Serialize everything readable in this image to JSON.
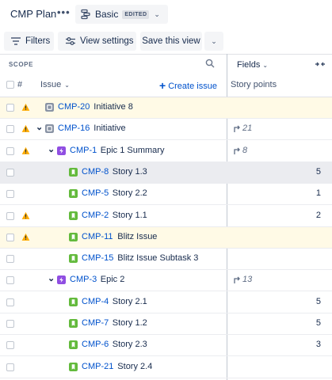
{
  "header": {
    "plan_title": "CMP Plan",
    "more_label": "•••",
    "view_name": "Basic",
    "view_badge": "EDITED"
  },
  "toolbar": {
    "filters_label": "Filters",
    "view_settings_label": "View settings",
    "save_view_label": "Save this view"
  },
  "scope": {
    "label": "SCOPE",
    "col_hash": "#",
    "col_issue": "Issue",
    "create_issue_label": "Create issue"
  },
  "fields": {
    "label": "Fields",
    "story_points_label": "Story points"
  },
  "rows": [
    {
      "key": "CMP-20",
      "summary": "Initiative 8",
      "type": "initiative",
      "warning": true,
      "expand": false,
      "story_points": "",
      "rollup": ""
    },
    {
      "key": "CMP-16",
      "summary": "Initiative",
      "type": "initiative",
      "warning": true,
      "expand": true,
      "story_points": "",
      "rollup": "21"
    },
    {
      "key": "CMP-1",
      "summary": "Epic 1 Summary",
      "type": "epic",
      "warning": true,
      "expand": true,
      "story_points": "",
      "rollup": "8"
    },
    {
      "key": "CMP-8",
      "summary": "Story 1.3",
      "type": "story",
      "warning": false,
      "expand": false,
      "story_points": "5",
      "rollup": ""
    },
    {
      "key": "CMP-5",
      "summary": "Story 2.2",
      "type": "story",
      "warning": false,
      "expand": false,
      "story_points": "1",
      "rollup": ""
    },
    {
      "key": "CMP-2",
      "summary": "Story 1.1",
      "type": "story",
      "warning": true,
      "expand": false,
      "story_points": "2",
      "rollup": ""
    },
    {
      "key": "CMP-11",
      "summary": "Blitz Issue",
      "type": "story",
      "warning": true,
      "expand": false,
      "story_points": "",
      "rollup": ""
    },
    {
      "key": "CMP-15",
      "summary": "Blitz Issue Subtask 3",
      "type": "story",
      "warning": false,
      "expand": false,
      "story_points": "",
      "rollup": ""
    },
    {
      "key": "CMP-3",
      "summary": "Epic 2",
      "type": "epic",
      "warning": false,
      "expand": true,
      "story_points": "",
      "rollup": "13"
    },
    {
      "key": "CMP-4",
      "summary": "Story 2.1",
      "type": "story",
      "warning": false,
      "expand": false,
      "story_points": "5",
      "rollup": ""
    },
    {
      "key": "CMP-7",
      "summary": "Story 1.2",
      "type": "story",
      "warning": false,
      "expand": false,
      "story_points": "5",
      "rollup": ""
    },
    {
      "key": "CMP-6",
      "summary": "Story 2.3",
      "type": "story",
      "warning": false,
      "expand": false,
      "story_points": "3",
      "rollup": ""
    },
    {
      "key": "CMP-21",
      "summary": "Story 2.4",
      "type": "story",
      "warning": false,
      "expand": false,
      "story_points": "",
      "rollup": ""
    }
  ],
  "colors": {
    "link": "#0052cc",
    "warning_bg": "#fffae6",
    "selected_bg": "#ebecf0",
    "initiative_icon": "#8993a4",
    "epic_icon": "#904ee2",
    "story_icon": "#63ba3c",
    "warning_icon": "#ffab00"
  }
}
